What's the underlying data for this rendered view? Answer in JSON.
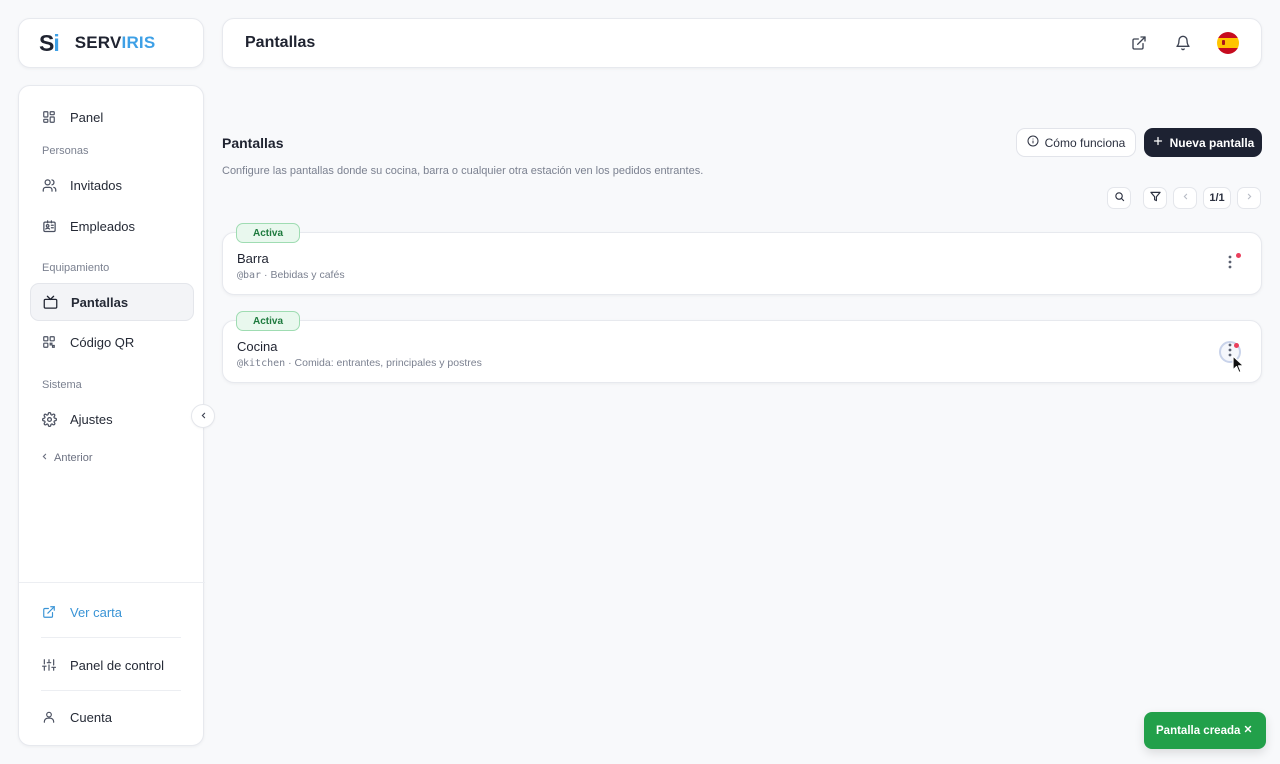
{
  "logo": {
    "mark_s": "S",
    "mark_i": "i",
    "text_serv": "SERV",
    "text_iris": "IRIS"
  },
  "header": {
    "title": "Pantallas",
    "icons": [
      "external-link-icon",
      "bell-icon",
      "spain-flag-icon"
    ]
  },
  "sidebar": {
    "items": [
      {
        "label": "Panel",
        "icon": "grid-icon"
      },
      {
        "label": "Invitados",
        "icon": "users-icon"
      },
      {
        "label": "Empleados",
        "icon": "id-card-icon"
      },
      {
        "label": "Pantallas",
        "icon": "tv-icon",
        "active": true
      },
      {
        "label": "Código QR",
        "icon": "qr-code-icon"
      },
      {
        "label": "Ajustes",
        "icon": "gear-icon"
      }
    ],
    "sections": {
      "people": "Personas",
      "equipment": "Equipamiento",
      "system": "Sistema"
    },
    "back_label": "Anterior",
    "bottom": [
      {
        "label": "Ver carta",
        "icon": "external-link-icon"
      },
      {
        "label": "Panel de control",
        "icon": "sliders-icon"
      },
      {
        "label": "Cuenta",
        "icon": "user-icon"
      }
    ]
  },
  "main": {
    "title": "Pantallas",
    "description": "Configure las pantallas donde su cocina, barra o cualquier otra estación ven los pedidos entrantes.",
    "how_button": "Cómo funciona",
    "new_button": "Nueva pantalla",
    "pagination": "1/1",
    "screens": [
      {
        "status": "Activa",
        "name": "Barra",
        "handle": "@bar",
        "separator": " · ",
        "description": "Bebidas y cafés"
      },
      {
        "status": "Activa",
        "name": "Cocina",
        "handle": "@kitchen",
        "separator": " · ",
        "description": "Comida: entrantes, principales y postres"
      }
    ]
  },
  "toast": {
    "message": "Pantalla creada"
  },
  "colors": {
    "brand_blue": "#3ea0e6",
    "primary_dark": "#1d2232",
    "success": "#22a04a",
    "badge_bg": "#e9f8ee",
    "notification_dot": "#ea3f5c"
  }
}
